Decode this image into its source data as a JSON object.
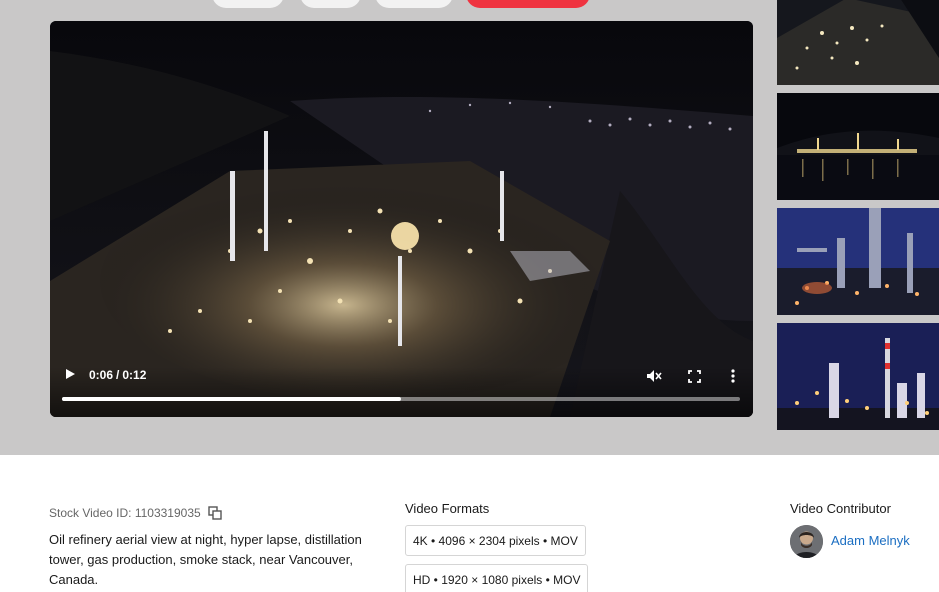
{
  "player": {
    "current_time": "0:06",
    "separator": "/",
    "duration": "0:12",
    "progress_fraction": 0.5,
    "icons": {
      "play": "play-icon",
      "mute": "volume-muted-icon",
      "fullscreen": "fullscreen-icon",
      "more": "more-vertical-icon"
    }
  },
  "details": {
    "stock_id_label": "Stock Video ID: 1103319035",
    "description": "Oil refinery aerial view at night, hyper lapse, distillation tower, gas production, smoke stack, near Vancouver, Canada."
  },
  "formats": {
    "title": "Video Formats",
    "items": [
      {
        "label": "4K • 4096 × 2304 pixels • MOV"
      },
      {
        "label": "HD • 1920 × 1080 pixels • MOV"
      }
    ]
  },
  "contributor": {
    "title": "Video Contributor",
    "name": "Adam Melnyk"
  },
  "colors": {
    "accent": "#ef3340",
    "link": "#1b6ec2",
    "stage_bg": "#c9c8c8"
  }
}
